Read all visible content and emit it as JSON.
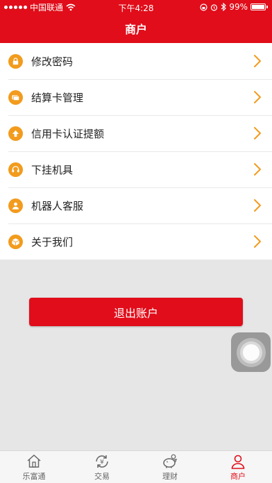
{
  "status_bar": {
    "carrier": "中国联通",
    "time": "下午4:28",
    "battery": "99%",
    "battery_level": 0.99
  },
  "header": {
    "title": "商户"
  },
  "menu": [
    {
      "label": "修改密码",
      "icon": "lock-icon"
    },
    {
      "label": "结算卡管理",
      "icon": "card-icon"
    },
    {
      "label": "信用卡认证提额",
      "icon": "arrow-up-icon"
    },
    {
      "label": "下挂机具",
      "icon": "headset-icon"
    },
    {
      "label": "机器人客服",
      "icon": "user-icon"
    },
    {
      "label": "关于我们",
      "icon": "box-icon"
    }
  ],
  "logout_label": "退出账户",
  "tabs": [
    {
      "label": "乐富通",
      "icon": "home-icon",
      "active": false
    },
    {
      "label": "交易",
      "icon": "yen-exchange-icon",
      "active": false
    },
    {
      "label": "理财",
      "icon": "piggy-bank-icon",
      "active": false
    },
    {
      "label": "商户",
      "icon": "person-icon",
      "active": true
    }
  ],
  "colors": {
    "brand_red": "#e10d1a",
    "icon_orange": "#f29b1d",
    "background": "#e6e6e6"
  }
}
